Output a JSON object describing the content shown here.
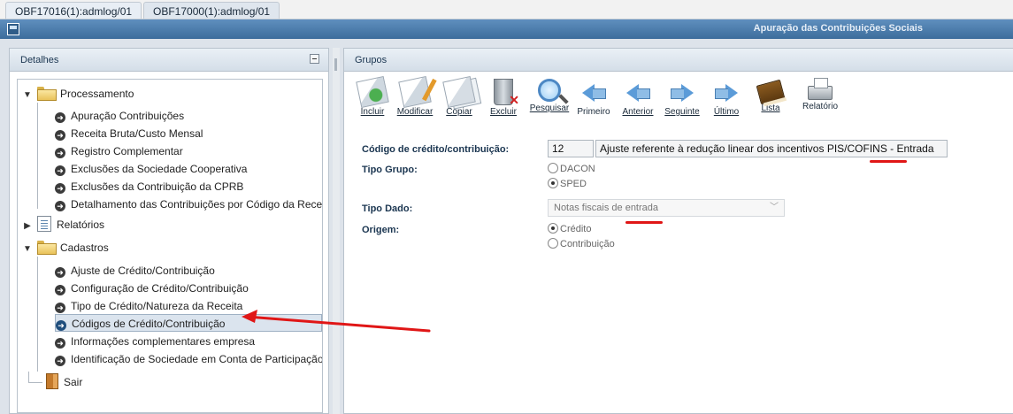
{
  "tabs": [
    "OBF17016(1):admlog/01",
    "OBF17000(1):admlog/01"
  ],
  "window": {
    "title": "Apuração das Contribuições Sociais"
  },
  "left": {
    "title": "Detalhes",
    "tree": {
      "processamento": {
        "label": "Processamento",
        "items": [
          "Apuração Contribuições",
          "Receita Bruta/Custo Mensal",
          "Registro Complementar",
          "Exclusões da Sociedade Cooperativa",
          "Exclusões da Contribuição da CPRB",
          "Detalhamento das Contribuições por Código da Rece"
        ]
      },
      "relatorios": {
        "label": "Relatórios"
      },
      "cadastros": {
        "label": "Cadastros",
        "items": [
          "Ajuste de Crédito/Contribuição",
          "Configuração de Crédito/Contribuição",
          "Tipo de Crédito/Natureza da Receita",
          "Códigos de Crédito/Contribuição",
          "Informações complementares empresa",
          "Identificação de Sociedade em Conta de Participação"
        ]
      },
      "sair": {
        "label": "Sair"
      }
    }
  },
  "right": {
    "title": "Grupos",
    "toolbar": {
      "incluir": "Incluir",
      "modificar": "Modificar",
      "copiar": "Copiar",
      "excluir": "Excluir",
      "pesquisar": "Pesquisar",
      "primeiro": "Primeiro",
      "anterior": "Anterior",
      "seguinte": "Seguinte",
      "ultimo": "Último",
      "lista": "Lista",
      "relatorio": "Relatório"
    },
    "form": {
      "codigo_label": "Código de crédito/contribuição:",
      "codigo_value": "12",
      "descricao_value": "Ajuste referente à redução linear dos incentivos PIS/COFINS - Entrada",
      "tipo_grupo_label": "Tipo Grupo:",
      "tipo_grupo_options": [
        "DACON",
        "SPED"
      ],
      "tipo_grupo_selected": "SPED",
      "tipo_dado_label": "Tipo Dado:",
      "tipo_dado_value": "Notas fiscais de entrada",
      "origem_label": "Origem:",
      "origem_options": [
        "Crédito",
        "Contribuição"
      ],
      "origem_selected": "Crédito"
    }
  },
  "colors": {
    "titlebar": "#3d6d9c",
    "annotation": "#e01616",
    "selection": "#dbe4ee"
  }
}
